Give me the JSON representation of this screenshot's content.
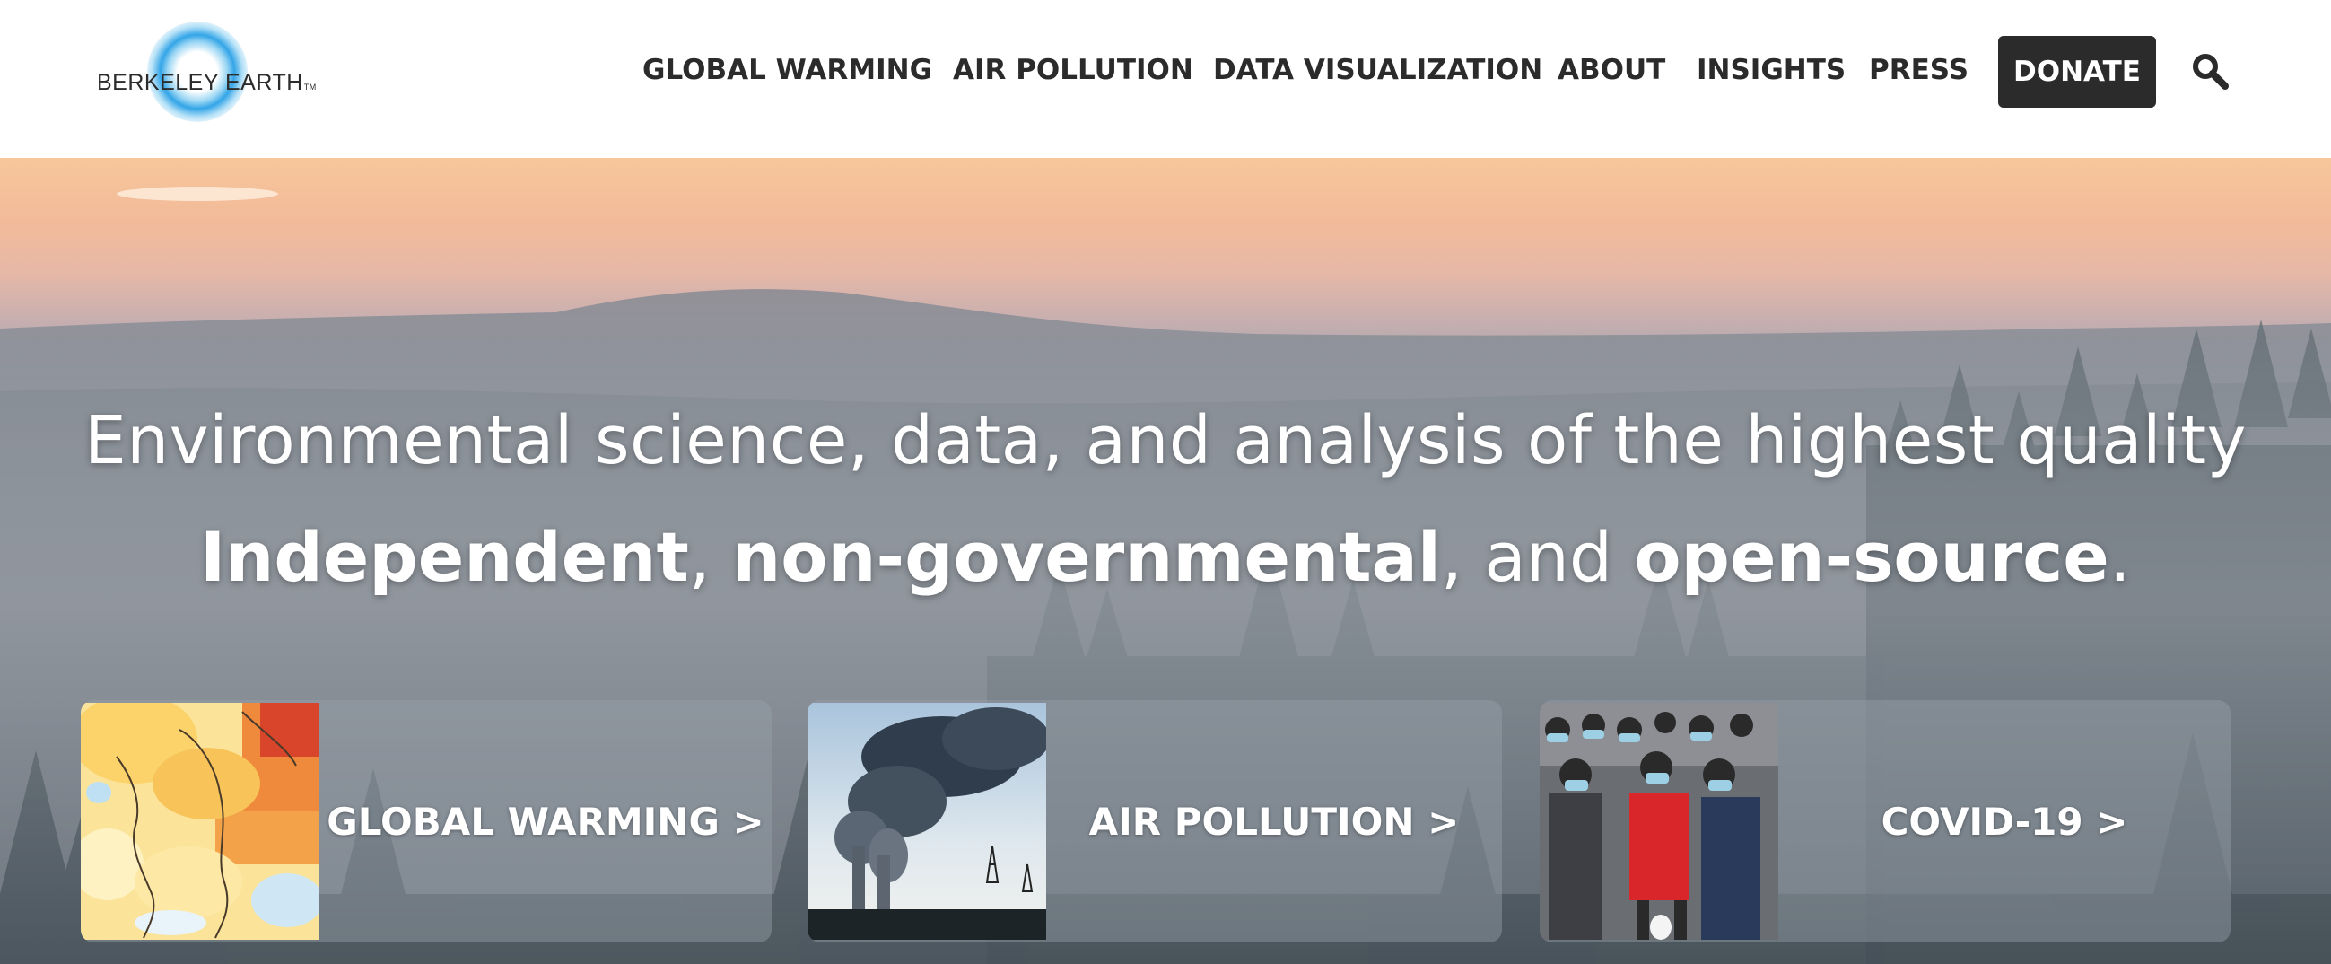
{
  "brand": {
    "name": "BERKELEY EARTH",
    "tm": "TM"
  },
  "nav": {
    "items": [
      {
        "label": "GLOBAL WARMING"
      },
      {
        "label": "AIR POLLUTION"
      },
      {
        "label": "DATA VISUALIZATION"
      },
      {
        "label": "ABOUT"
      },
      {
        "label": "INSIGHTS"
      },
      {
        "label": "PRESS"
      }
    ],
    "donate": "DONATE",
    "search_icon": "search-icon"
  },
  "hero": {
    "headline": "Environmental science, data, and analysis of the highest quality",
    "tagline": {
      "part1": "Independent",
      "sep1": ", ",
      "part2": "non-governmental",
      "sep2": ", and ",
      "part3": "open-source",
      "end": "."
    }
  },
  "cards": [
    {
      "label": "GLOBAL WARMING >",
      "image": "temperature-map"
    },
    {
      "label": "AIR POLLUTION >",
      "image": "smokestacks-photo"
    },
    {
      "label": "COVID-19 >",
      "image": "masked-crowd-photo"
    }
  ],
  "colors": {
    "nav_text": "#2b2b2b",
    "donate_bg": "#2b2b2b",
    "logo_ring": "#28a0e6",
    "hero_text": "#ffffff"
  }
}
